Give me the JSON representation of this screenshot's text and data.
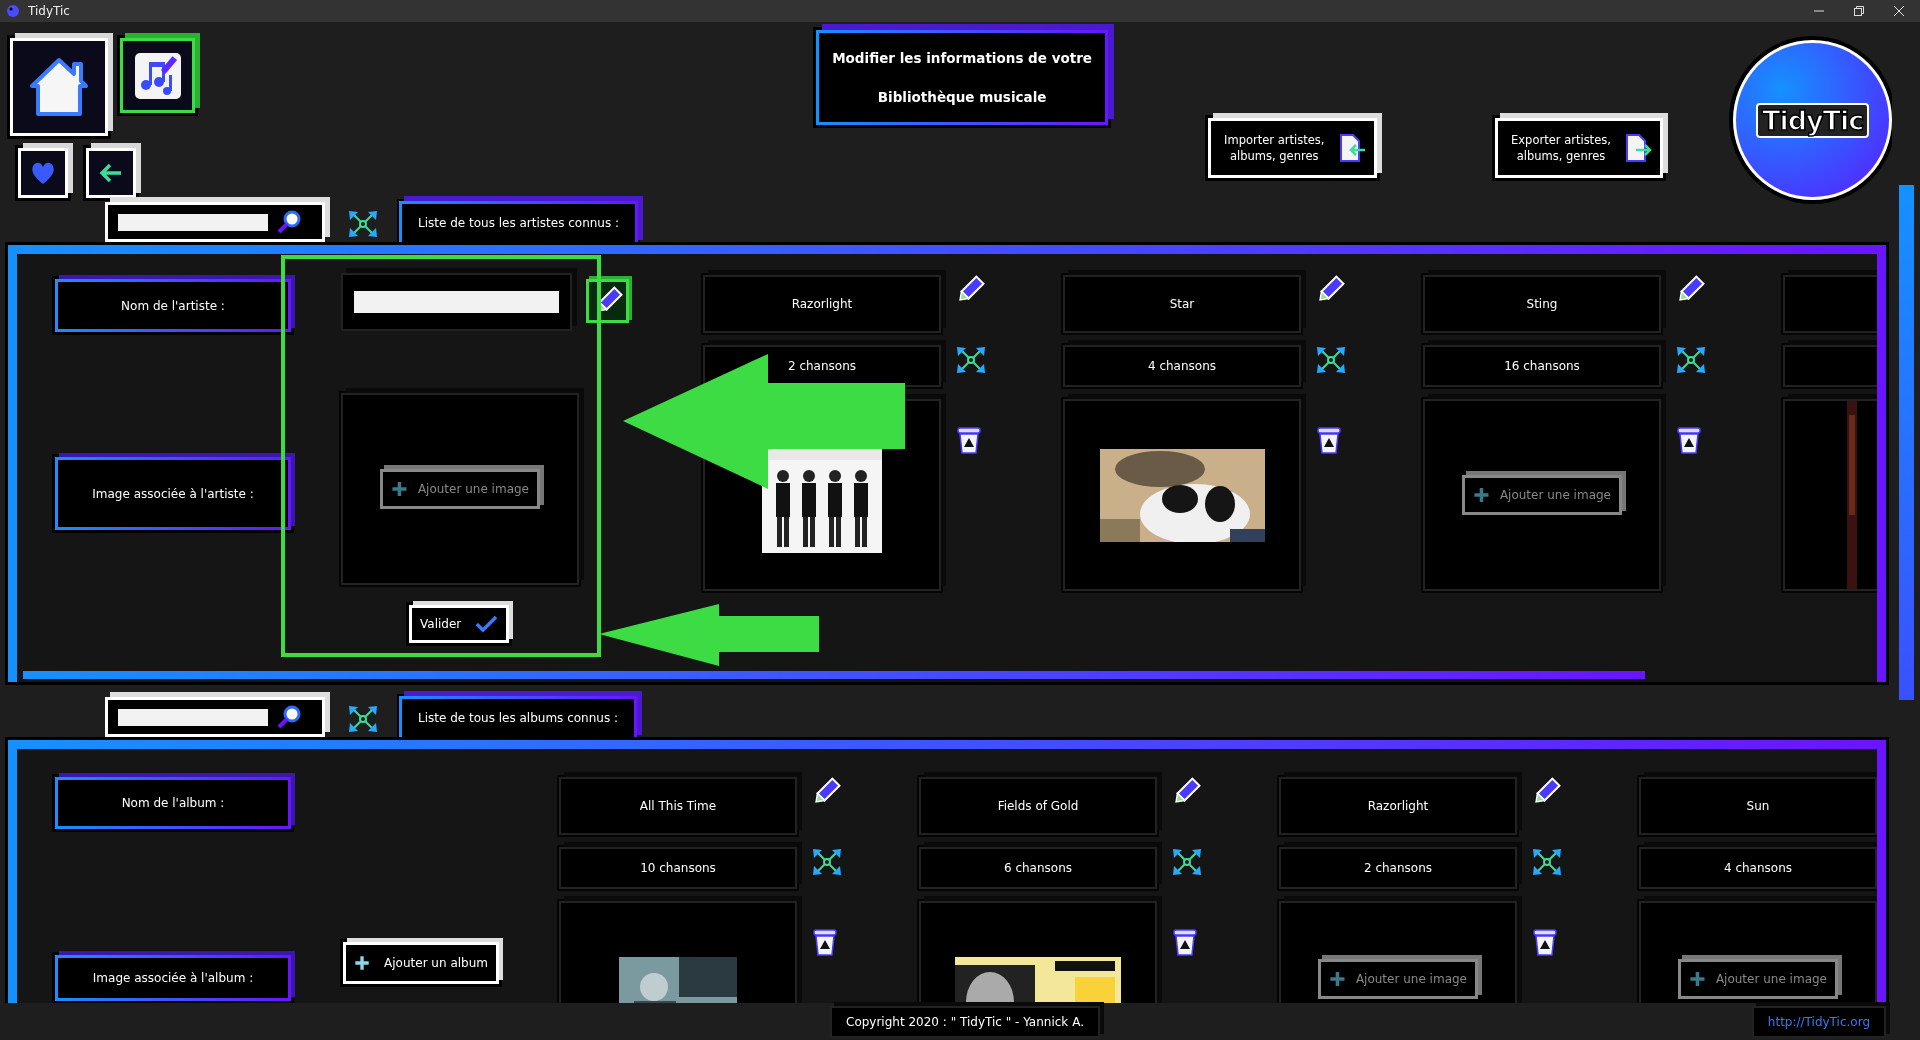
{
  "window": {
    "title": "TidyTic"
  },
  "nav": [
    {
      "kind": "home",
      "selected": false
    },
    {
      "kind": "library",
      "selected": true
    },
    {
      "kind": "favorites",
      "selected": false
    },
    {
      "kind": "back",
      "selected": false
    }
  ],
  "heading": {
    "lines": [
      "Modifier les informations de votre",
      "Bibliothèque musicale"
    ]
  },
  "actions": [
    {
      "kind": "import",
      "lines": [
        "Importer artistes,",
        "albums, genres"
      ]
    },
    {
      "kind": "export",
      "lines": [
        "Exporter artistes,",
        "albums, genres"
      ]
    }
  ],
  "logo": {
    "text": "TidyTic"
  },
  "artists": {
    "tab": "Liste de tous les artistes connus :",
    "row_labels": [
      "Nom de l'artiste :",
      "Image associée à l'artiste :"
    ],
    "new_entry": {
      "add_image": "Ajouter une image",
      "confirm": "Valider"
    },
    "items": [
      {
        "name": "Razorlight",
        "count": "2 chansons",
        "image": {
          "kind": "picture"
        }
      },
      {
        "name": "Star",
        "count": "4 chansons",
        "image": {
          "kind": "picture"
        }
      },
      {
        "name": "Sting",
        "count": "16 chansons",
        "image": {
          "kind": "add",
          "label": "Ajouter une image"
        }
      },
      {
        "image": {
          "kind": "picture"
        }
      }
    ]
  },
  "albums": {
    "tab": "Liste de tous les albums connus :",
    "row_labels": [
      "Nom de l'album :",
      "Image associée à l'album :"
    ],
    "add_album": "Ajouter un album",
    "items": [
      {
        "name": "All This Time",
        "count": "10 chansons",
        "image": {
          "kind": "picture"
        }
      },
      {
        "name": "Fields of Gold",
        "count": "6 chansons",
        "image": {
          "kind": "picture"
        }
      },
      {
        "name": "Razorlight",
        "count": "2 chansons",
        "image": {
          "kind": "add",
          "label": "Ajouter une image"
        }
      },
      {
        "name": "Sun",
        "count": "4 chansons",
        "image": {
          "kind": "add",
          "label": "Ajouter une image"
        }
      }
    ]
  },
  "footer": {
    "copyright": "Copyright 2020 : \" TidyTic \" - Yannick A.",
    "link": "http://TidyTic.org"
  }
}
